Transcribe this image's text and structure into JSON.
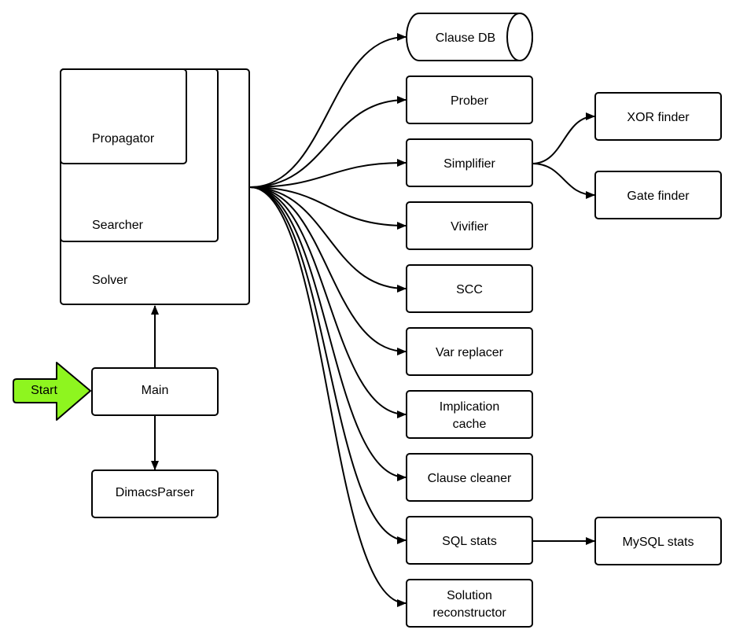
{
  "colors": {
    "start_fill": "#8ef51f",
    "stroke": "#000000",
    "box_fill": "#ffffff"
  },
  "start": {
    "label": "Start"
  },
  "main": {
    "label": "Main"
  },
  "parser": {
    "label": "DimacsParser"
  },
  "solver": {
    "label": "Solver",
    "searcher": "Searcher",
    "propagator": "Propagator"
  },
  "modules": [
    {
      "lines": [
        "Clause DB"
      ],
      "shape": "cylinder"
    },
    {
      "lines": [
        "Prober"
      ]
    },
    {
      "lines": [
        "Simplifier"
      ]
    },
    {
      "lines": [
        "Vivifier"
      ]
    },
    {
      "lines": [
        "SCC"
      ]
    },
    {
      "lines": [
        "Var replacer"
      ]
    },
    {
      "lines": [
        "Implication",
        "cache"
      ]
    },
    {
      "lines": [
        "Clause cleaner"
      ]
    },
    {
      "lines": [
        "SQL stats"
      ]
    },
    {
      "lines": [
        "Solution",
        "reconstructor"
      ]
    }
  ],
  "simplifier_children": [
    {
      "label": "XOR finder"
    },
    {
      "label": "Gate finder"
    }
  ],
  "sql_child": {
    "label": "MySQL stats"
  }
}
